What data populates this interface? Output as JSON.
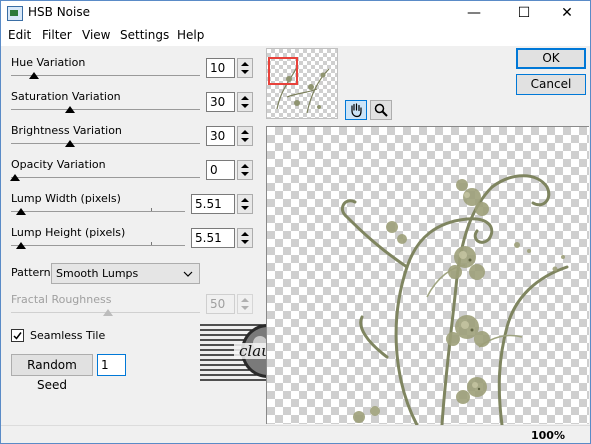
{
  "window": {
    "title": "HSB Noise",
    "minimize_glyph": "—",
    "maximize_glyph": "☐",
    "close_glyph": "✕"
  },
  "menu": [
    "Edit",
    "Filter",
    "View",
    "Settings",
    "Help"
  ],
  "controls": {
    "hue": {
      "label": "Hue Variation",
      "value": "10"
    },
    "saturation": {
      "label": "Saturation Variation",
      "value": "30"
    },
    "brightness": {
      "label": "Brightness Variation",
      "value": "30"
    },
    "opacity": {
      "label": "Opacity Variation",
      "value": "0"
    },
    "lump_width": {
      "label": "Lump Width (pixels)",
      "value": "5.51"
    },
    "lump_height": {
      "label": "Lump Height (pixels)",
      "value": "5.51"
    },
    "pattern": {
      "label": "Pattern:",
      "selected": "Smooth Lumps"
    },
    "fractal": {
      "label": "Fractal Roughness",
      "value": "50"
    },
    "seamless": {
      "label": "Seamless Tile",
      "checked": true
    },
    "random_seed": {
      "label": "Random Seed",
      "value": "1"
    }
  },
  "buttons": {
    "ok": "OK",
    "cancel": "Cancel"
  },
  "watermark": {
    "text": "claudia"
  },
  "status": {
    "zoom": "100%"
  }
}
